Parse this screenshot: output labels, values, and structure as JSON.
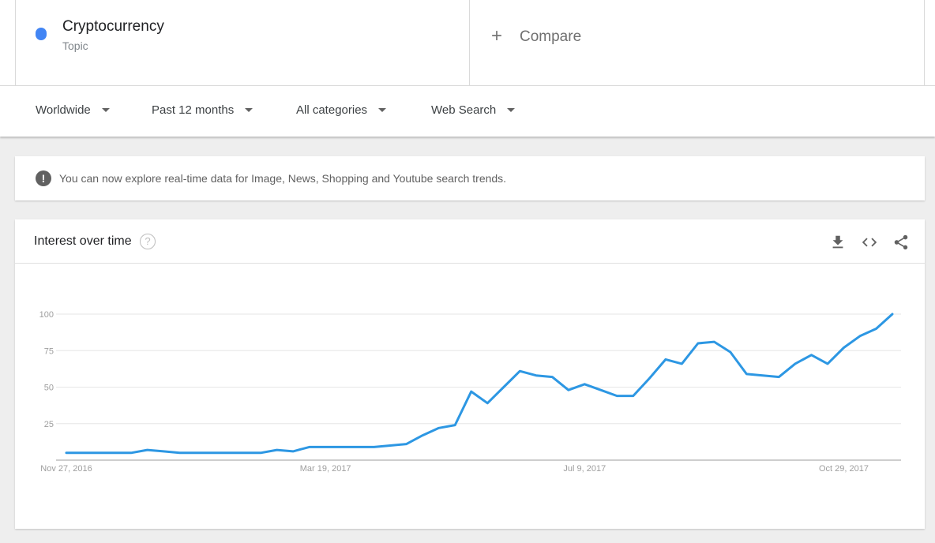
{
  "term": {
    "name": "Cryptocurrency",
    "type": "Topic",
    "color": "#4285f4"
  },
  "compare": {
    "icon": "plus-icon",
    "label": "Compare"
  },
  "filters": [
    {
      "label": "Worldwide"
    },
    {
      "label": "Past 12 months"
    },
    {
      "label": "All categories"
    },
    {
      "label": "Web Search"
    }
  ],
  "notice": {
    "icon": "exclamation-icon",
    "text": "You can now explore real-time data for Image, News, Shopping and Youtube search trends."
  },
  "interest_over_time": {
    "title": "Interest over time",
    "help_icon": "help-icon",
    "actions": [
      "download-icon",
      "embed-code-icon",
      "share-icon"
    ]
  },
  "chart_data": {
    "type": "line",
    "title": "",
    "xlabel": "",
    "ylabel": "",
    "ylim": [
      0,
      100
    ],
    "yticks": [
      "25",
      "50",
      "75",
      "100"
    ],
    "x_tick_labels": [
      "Nov 27, 2016",
      "Mar 19, 2017",
      "Jul 9, 2017",
      "Oct 29, 2017"
    ],
    "grid": true,
    "line_color": "#2d97e3",
    "series": [
      {
        "x": [
          "2016-11-27",
          "2016-12-04",
          "2016-12-11",
          "2016-12-18",
          "2016-12-25",
          "2017-01-01",
          "2017-01-08",
          "2017-01-15",
          "2017-01-22",
          "2017-01-29",
          "2017-02-05",
          "2017-02-12",
          "2017-02-19",
          "2017-02-26",
          "2017-03-05",
          "2017-03-12",
          "2017-03-19",
          "2017-03-26",
          "2017-04-02",
          "2017-04-09",
          "2017-04-16",
          "2017-04-23",
          "2017-04-30",
          "2017-05-07",
          "2017-05-14",
          "2017-05-21",
          "2017-05-28",
          "2017-06-04",
          "2017-06-11",
          "2017-06-18",
          "2017-06-25",
          "2017-07-02",
          "2017-07-09",
          "2017-07-16",
          "2017-07-23",
          "2017-07-30",
          "2017-08-06",
          "2017-08-13",
          "2017-08-20",
          "2017-08-27",
          "2017-09-03",
          "2017-09-10",
          "2017-09-17",
          "2017-09-24",
          "2017-10-01",
          "2017-10-08",
          "2017-10-15",
          "2017-10-22",
          "2017-10-29",
          "2017-11-05",
          "2017-11-12",
          "2017-11-19"
        ],
        "values": [
          5,
          5,
          5,
          5,
          5,
          7,
          6,
          5,
          5,
          5,
          5,
          5,
          5,
          7,
          6,
          9,
          9,
          9,
          9,
          9,
          10,
          11,
          17,
          22,
          24,
          47,
          39,
          50,
          61,
          58,
          57,
          48,
          52,
          48,
          44,
          44,
          56,
          69,
          66,
          80,
          81,
          74,
          59,
          58,
          57,
          66,
          72,
          66,
          77,
          85,
          90,
          100
        ]
      }
    ]
  }
}
